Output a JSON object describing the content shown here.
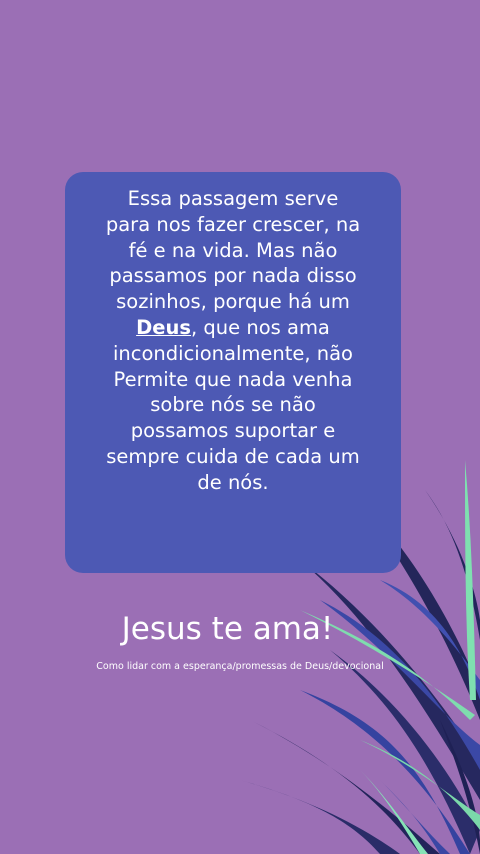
{
  "card": {
    "lines": [
      "Essa passagem serve",
      "para nos fazer crescer, na",
      "fé e na vida. Mas não",
      "passamos por nada disso",
      "sozinhos, porque há um",
      "Deus",
      ", que nos ama",
      "incondicionalmente, não",
      "Permite que nada venha",
      "sobre nós se não",
      "possamos suportar e",
      "sempre cuida de cada um",
      "de nós."
    ]
  },
  "headline": "Jesus te ama!",
  "caption": "Como lidar com a esperança/promessas de Deus/devocional",
  "colors": {
    "background": "#9b6fb5",
    "card": "#4d59b4",
    "leaf_dark": "#2a2a6e",
    "leaf_blue": "#3a4aa8",
    "leaf_mint": "#7fe0b0"
  }
}
